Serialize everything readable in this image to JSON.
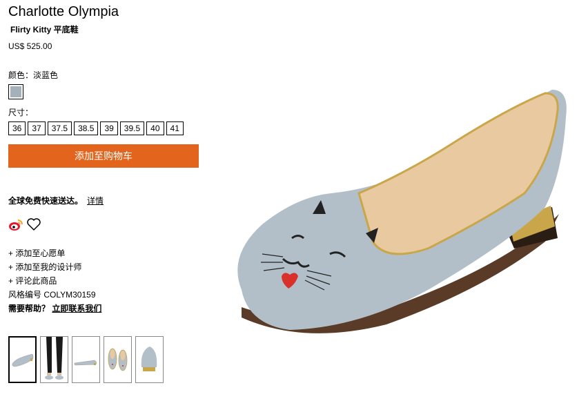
{
  "product": {
    "brand": "Charlotte Olympia",
    "name": "Flirty Kitty 平底鞋",
    "price": "US$ 525.00",
    "color_label": "颜色：淡蓝色",
    "swatch_color": "#a4b0ba",
    "size_label": "尺寸：",
    "sizes": [
      "36",
      "37",
      "37.5",
      "38.5",
      "39",
      "39.5",
      "40",
      "41"
    ],
    "add_to_cart": "添加至购物车",
    "shipping_text": "全球免费快速送达。",
    "shipping_link": "详情",
    "actions": {
      "wishlist": "+ 添加至心愿单",
      "designers": "+ 添加至我的设计师",
      "review": "+ 评论此商品"
    },
    "style_number": "风格编号 COLYM30159",
    "help_label": "需要帮助？",
    "help_link": "立即联系我们"
  },
  "icons": {
    "share": "weibo-icon",
    "favorite": "heart-icon"
  },
  "colors": {
    "accent": "#e3651d",
    "shoe": "#b3bfc8",
    "gold": "#c9a64a"
  },
  "thumbnail_count": 5
}
